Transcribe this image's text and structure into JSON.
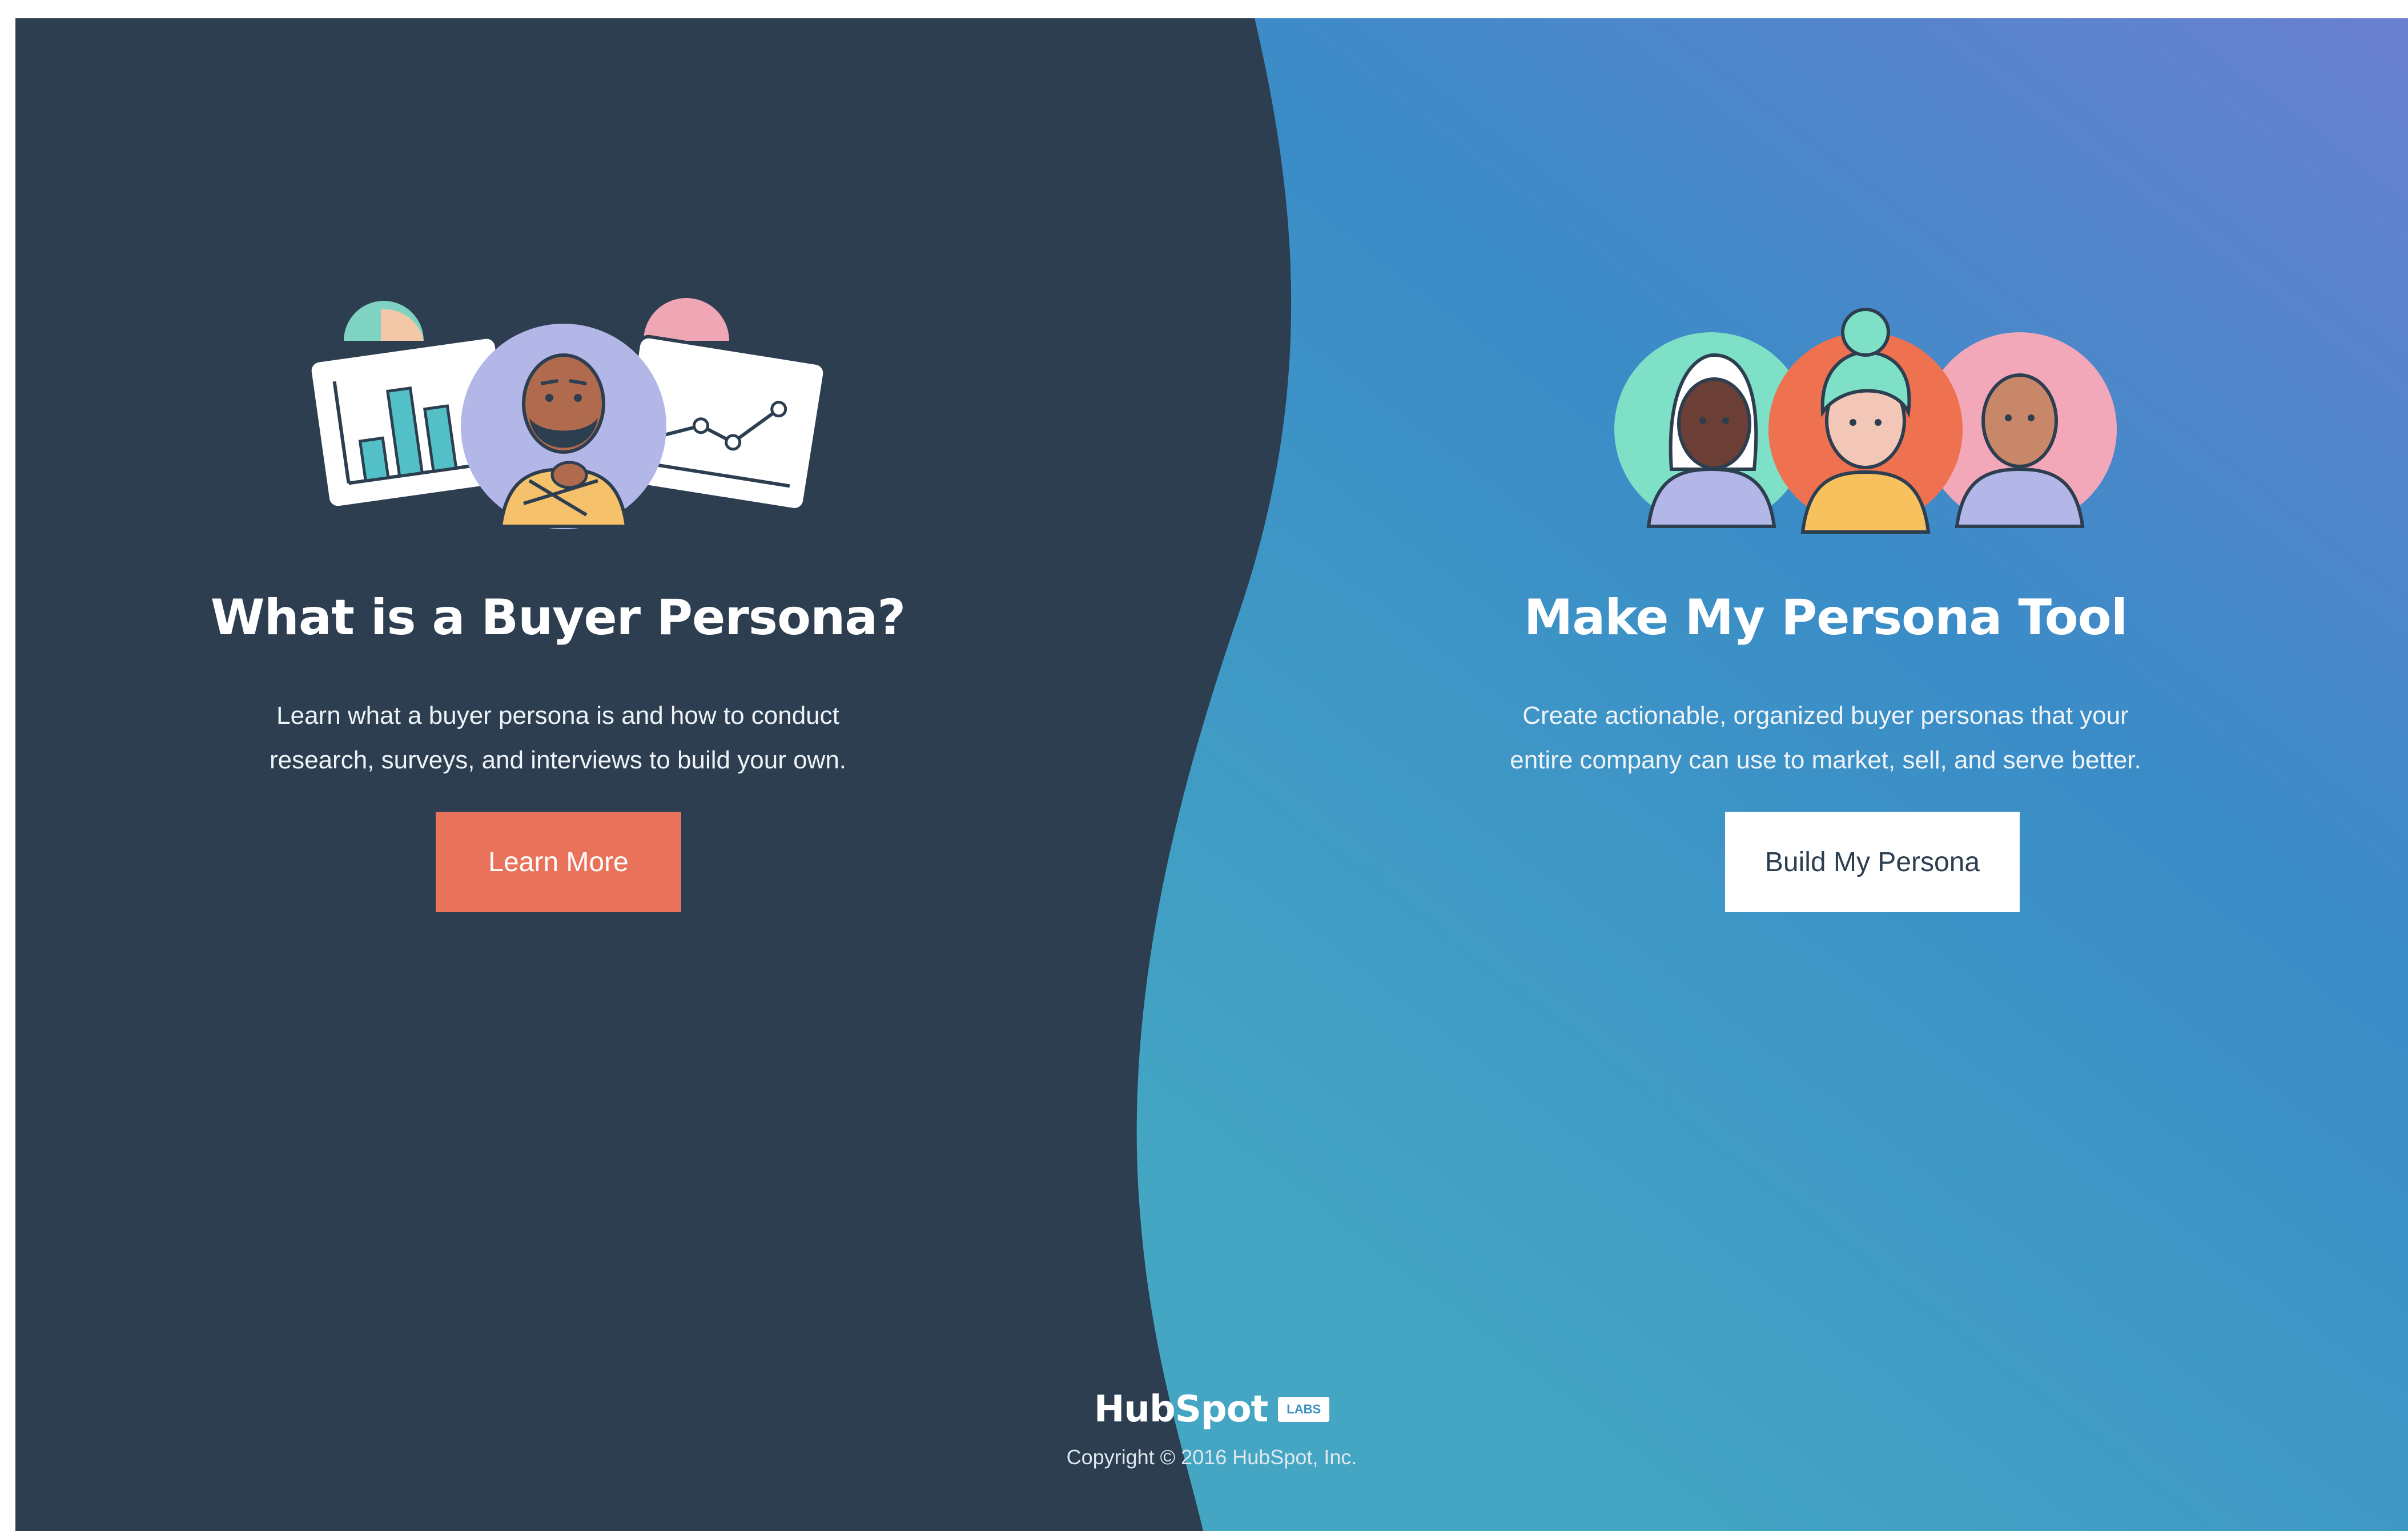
{
  "left": {
    "title": "What is a Buyer Persona?",
    "description_line1": "Learn what a buyer persona is and how to conduct",
    "description_line2": "research, surveys, and interviews to build your own.",
    "button_label": "Learn More"
  },
  "right": {
    "title": "Make My Persona Tool",
    "description_line1": "Create actionable, organized buyer personas that your",
    "description_line2": "entire company can use to market, sell, and serve better.",
    "button_label": "Build My Persona"
  },
  "footer": {
    "brand": "HubSpot",
    "badge": "LABS",
    "copyright": "Copyright © 2016 HubSpot, Inc."
  },
  "colors": {
    "left_bg": "#2d3e50",
    "right_gradient_top": "#5b7fd1",
    "right_gradient_bottom": "#3f9ec4",
    "cta_orange": "#e8735a",
    "button_white": "#ffffff"
  },
  "icons": {
    "left_illustration": "persona-thinking-with-charts-icon",
    "right_illustration": "three-personas-icon"
  }
}
